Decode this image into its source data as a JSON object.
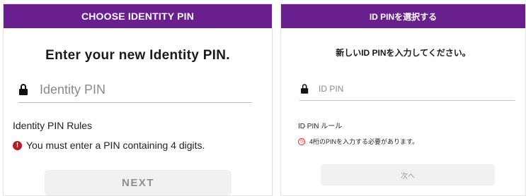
{
  "colors": {
    "header_bg": "#6a1f8f",
    "error": "#c0161d"
  },
  "english": {
    "header_title": "CHOOSE IDENTITY PIN",
    "prompt": "Enter your new Identity PIN.",
    "pin_placeholder": "Identity PIN",
    "rules_title": "Identity PIN Rules",
    "rule_error": "You must enter a PIN containing 4 digits.",
    "next_label": "NEXT"
  },
  "japanese": {
    "header_title": "ID PINを選択する",
    "prompt": "新しいID PINを入力してください。",
    "pin_placeholder": "ID PIN",
    "rules_title": "ID PIN ルール",
    "rule_error": "4桁のPINを入力する必要があります。",
    "next_label": "次へ"
  }
}
